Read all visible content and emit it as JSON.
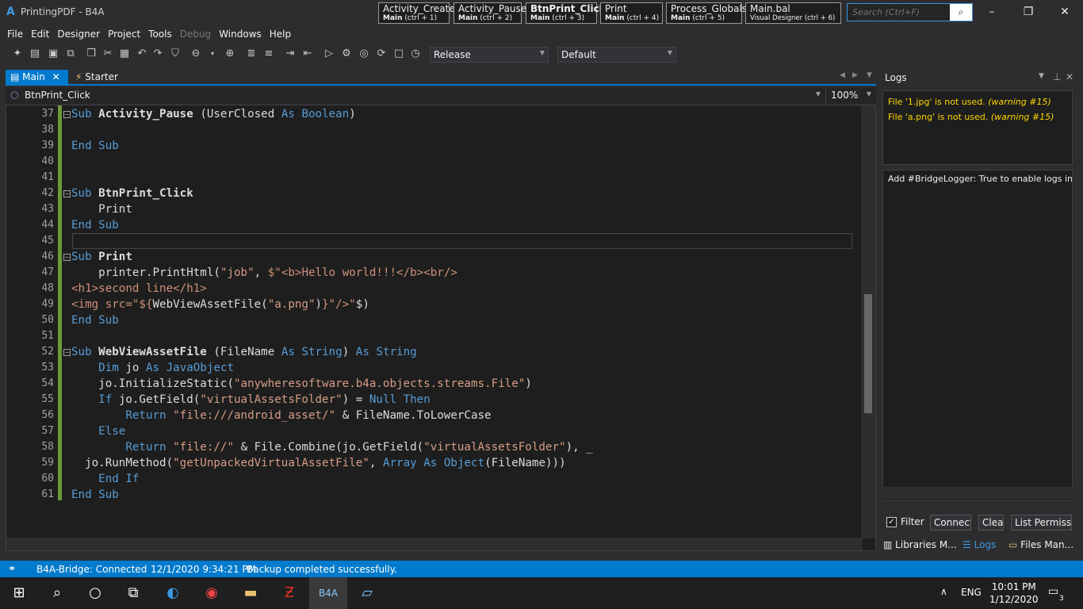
{
  "window": {
    "title": "PrintingPDF - B4A",
    "logo": "A",
    "minimize": "–",
    "maximize": "❐",
    "close": "✕"
  },
  "quick_tabs": [
    {
      "title": "Activity_Create",
      "module": "Main",
      "shortcut": "(ctrl + 1)"
    },
    {
      "title": "Activity_Pause",
      "module": "Main",
      "shortcut": "(ctrl + 2)"
    },
    {
      "title": "BtnPrint_Click",
      "module": "Main",
      "shortcut": "(ctrl + 3)"
    },
    {
      "title": "Print",
      "module": "Main",
      "shortcut": "(ctrl + 4)"
    },
    {
      "title": "Process_Globals",
      "module": "Main",
      "shortcut": "(ctrl + 5)"
    },
    {
      "title": "Main.bal",
      "module": "Visual Designer",
      "shortcut": "(ctrl + 6)"
    }
  ],
  "search": {
    "placeholder": "Search (Ctrl+F)"
  },
  "menu": [
    "File",
    "Edit",
    "Designer",
    "Project",
    "Tools",
    "Debug",
    "Windows",
    "Help"
  ],
  "toolbar": {
    "build_config": "Release",
    "build_target": "Default"
  },
  "doc_tabs": {
    "main": "Main",
    "starter": "Starter"
  },
  "method_selector": "BtnPrint_Click",
  "zoom": "100%",
  "code_lines": [
    "37",
    "38",
    "39",
    "40",
    "41",
    "42",
    "43",
    "44",
    "45",
    "46",
    "47",
    "48",
    "49",
    "50",
    "51",
    "52",
    "53",
    "54",
    "55",
    "56",
    "57",
    "58",
    "59",
    "60",
    "61"
  ],
  "logs": {
    "title": "Logs",
    "warnings": [
      {
        "text": "File '1.jpg' is not used.",
        "code": "(warning #15)"
      },
      {
        "text": "File 'a.png' is not used.",
        "code": "(warning #15)"
      }
    ],
    "message": "Add #BridgeLogger: True to enable logs in Re",
    "filter": "Filter",
    "connect": "Connect",
    "clear": "Clear",
    "list_permissions": "List Permissio",
    "tabs": {
      "libraries": "Libraries M...",
      "logs": "Logs",
      "files": "Files Man..."
    }
  },
  "status": {
    "bridge": "B4A-Bridge: Connected",
    "datetime": "12/1/2020 9:34:21 PM",
    "message": "Backup completed successfully."
  },
  "taskbar": {
    "lang": "ENG",
    "time": "10:01 PM",
    "date": "1/12/2020",
    "notifications": "3"
  },
  "colors": {
    "accent": "#007acc",
    "keyword": "#569cd6",
    "string": "#d69d85",
    "type": "#4ec9b0",
    "warning": "#ffd700"
  }
}
